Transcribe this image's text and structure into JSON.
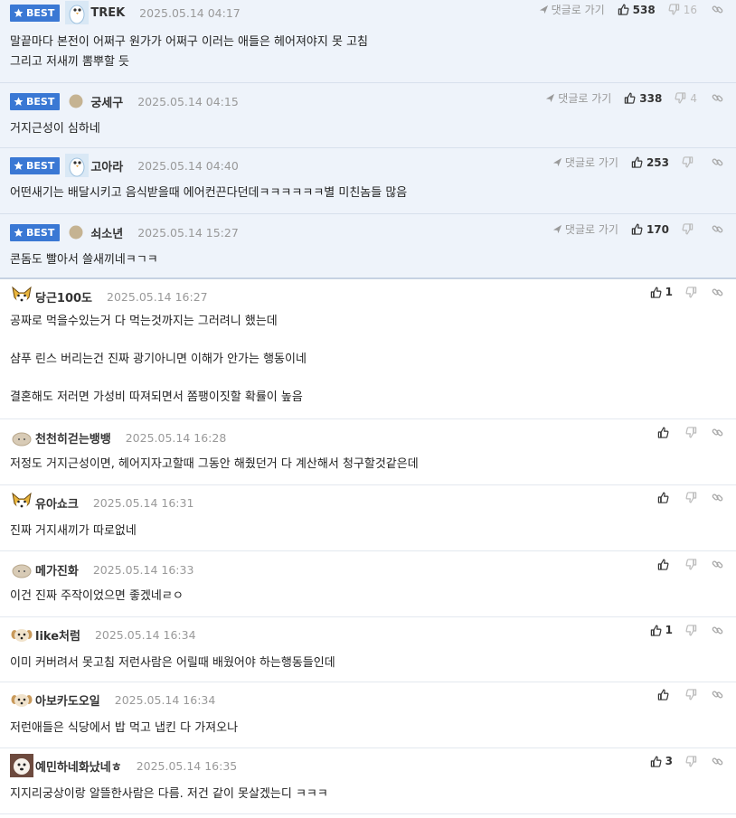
{
  "labels": {
    "best": "BEST",
    "goto_reply": "댓글로 가기"
  },
  "colors": {
    "best_badge": "#3a78d4",
    "best_bg": "#eef3fa",
    "meta_gray": "#999999"
  },
  "best_comments": [
    {
      "nickname": "TREK",
      "avatar": "penguin-avatar",
      "date": "2025.05.14 04:17",
      "likes": "538",
      "dislikes": "16",
      "lines": [
        "말끝마다 본전이 어쩌구 원가가 어쩌구 이러는 애들은 헤어져야지 못 고침",
        "그리고 저새끼 뽐뿌할 듯"
      ]
    },
    {
      "nickname": "궁세구",
      "avatar": "dot-avatar",
      "date": "2025.05.14 04:15",
      "likes": "338",
      "dislikes": "4",
      "lines": [
        "거지근성이 심하네"
      ]
    },
    {
      "nickname": "고아라",
      "avatar": "penguin-avatar",
      "date": "2025.05.14 04:40",
      "likes": "253",
      "dislikes": "",
      "lines": [
        "어떤새기는 배달시키고 음식받을때 에어컨끈다던데ㅋㅋㅋㅋㅋㅋ별 미친놈들 많음"
      ]
    },
    {
      "nickname": "쇠소년",
      "avatar": "dot-avatar",
      "date": "2025.05.14 15:27",
      "likes": "170",
      "dislikes": "",
      "lines": [
        "콘돔도 빨아서 쓸새끼네ㅋㄱㅋ"
      ]
    }
  ],
  "comments": [
    {
      "nickname": "당근100도",
      "avatar": "dog-avatar",
      "date": "2025.05.14 16:27",
      "likes": "1",
      "lines": [
        "공짜로 먹을수있는거 다 먹는것까지는 그러려니 했는데",
        "",
        "샴푸 린스 버리는건 진짜 광기아니면 이해가 안가는 행동이네",
        "",
        "결혼해도 저러면 가성비 따져되면서 쫌팽이짓할 확률이 높음"
      ]
    },
    {
      "nickname": "천천히걷는뱅뱅",
      "avatar": "bun-avatar",
      "date": "2025.05.14 16:28",
      "likes": "",
      "lines": [
        "저정도 거지근성이면, 헤어지자고할때 그동안 해줬던거 다 계산해서 청구할것같은데"
      ]
    },
    {
      "nickname": "유아쇼크",
      "avatar": "dog-avatar",
      "date": "2025.05.14 16:31",
      "likes": "",
      "lines": [
        "진짜 거지새끼가 따로없네"
      ]
    },
    {
      "nickname": "메가진화",
      "avatar": "bun-avatar",
      "date": "2025.05.14 16:33",
      "likes": "",
      "lines": [
        "이건 진짜 주작이었으면 좋겠네ㄹㅇ"
      ]
    },
    {
      "nickname": "like처럼",
      "avatar": "puppy-avatar",
      "date": "2025.05.14 16:34",
      "likes": "1",
      "lines": [
        "이미 커버려서 못고침 저런사람은 어릴때 배웠어야 하는행동들인데"
      ]
    },
    {
      "nickname": "아보카도오일",
      "avatar": "puppy-avatar",
      "date": "2025.05.14 16:34",
      "likes": "",
      "lines": [
        "저런애들은 식당에서 밥 먹고 냅킨 다 가져오나"
      ]
    },
    {
      "nickname": "예민하네화났네ㅎ",
      "avatar": "maltese-avatar",
      "date": "2025.05.14 16:35",
      "likes": "3",
      "lines": [
        "지지리궁상이랑 알뜰한사람은 다름. 저건 같이 못살겠는디 ㅋㅋㅋ"
      ]
    }
  ]
}
